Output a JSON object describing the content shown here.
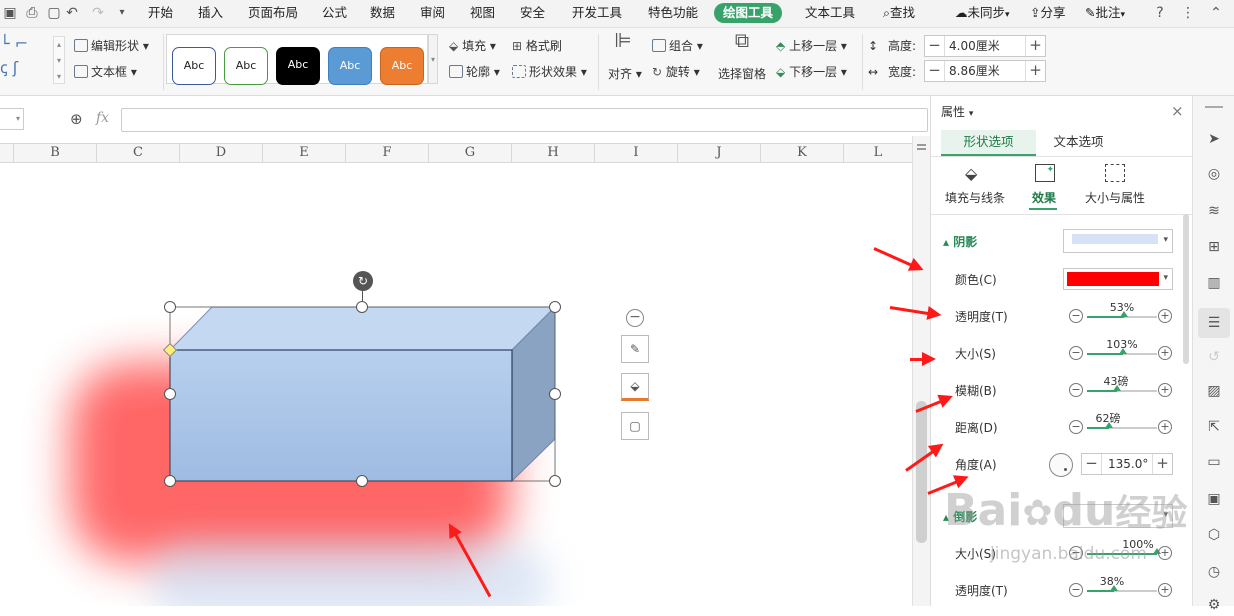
{
  "menu": {
    "tabs": [
      "开始",
      "插入",
      "页面布局",
      "公式",
      "数据",
      "审阅",
      "视图",
      "安全",
      "开发工具",
      "特色功能",
      "绘图工具",
      "文本工具"
    ],
    "search": "查找",
    "sync": "未同步",
    "share": "分享",
    "comment": "批注"
  },
  "ribbon": {
    "edit_shape": "编辑形状",
    "text_box": "文本框",
    "style_label": "Abc",
    "fill": "填充",
    "format_painter": "格式刷",
    "outline": "轮廓",
    "shape_effect": "形状效果",
    "align": "对齐",
    "group": "组合",
    "rotate": "旋转",
    "selection_pane": "选择窗格",
    "bring_forward": "上移一层",
    "send_backward": "下移一层",
    "height_label": "高度:",
    "height_value": "4.00厘米",
    "width_label": "宽度:",
    "width_value": "8.86厘米"
  },
  "formula_bar": {
    "fx": "fx",
    "content": ""
  },
  "columns": [
    "B",
    "C",
    "D",
    "E",
    "F",
    "G",
    "H",
    "I",
    "J",
    "K",
    "L"
  ],
  "panel": {
    "title": "属性",
    "tabs": [
      "形状选项",
      "文本选项"
    ],
    "subtabs": [
      "填充与线条",
      "效果",
      "大小与属性"
    ],
    "shadow_section": "阴影",
    "shadow": {
      "color_label": "颜色(C)",
      "color_value": "#ff0000",
      "transparency_label": "透明度(T)",
      "transparency": "53%",
      "transparency_pct": 53,
      "size_label": "大小(S)",
      "size": "103%",
      "size_pct": 52,
      "blur_label": "模糊(B)",
      "blur": "43磅",
      "blur_pct": 43,
      "distance_label": "距离(D)",
      "distance": "62磅",
      "distance_pct": 31,
      "angle_label": "角度(A)",
      "angle": "135.0°"
    },
    "reflection_section": "倒影",
    "reflection": {
      "size_label": "大小(S)",
      "size": "100%",
      "size_pct": 100,
      "transparency_label": "透明度(T)",
      "transparency": "38%",
      "transparency_pct": 38
    }
  },
  "watermark": {
    "brand": "Bai",
    "brand2": "du",
    "brand3": "经验",
    "url": "jingyan.baidu.com"
  },
  "colors": {
    "accent": "#37a26a",
    "shape_fill": "#a9c4e6",
    "shadow": "#ff5a5a"
  }
}
